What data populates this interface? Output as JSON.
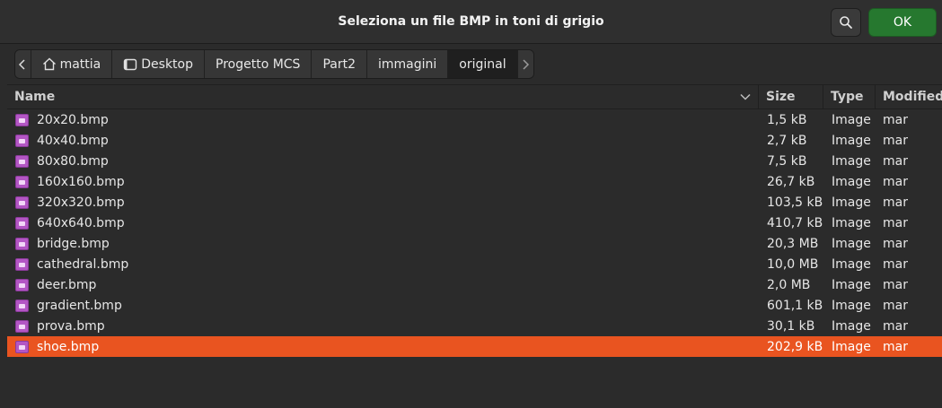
{
  "dialog": {
    "title": "Seleziona un file BMP in toni di grigio",
    "ok_label": "OK"
  },
  "pathbar": {
    "crumbs": [
      "mattia",
      "Desktop",
      "Progetto MCS",
      "Part2",
      "immagini",
      "original"
    ]
  },
  "list": {
    "columns": {
      "name": "Name",
      "size": "Size",
      "type": "Type",
      "modified": "Modified"
    },
    "files": [
      {
        "name": "20x20.bmp",
        "size": "1,5 kB",
        "type": "Image",
        "modified": "mar"
      },
      {
        "name": "40x40.bmp",
        "size": "2,7 kB",
        "type": "Image",
        "modified": "mar"
      },
      {
        "name": "80x80.bmp",
        "size": "7,5 kB",
        "type": "Image",
        "modified": "mar"
      },
      {
        "name": "160x160.bmp",
        "size": "26,7 kB",
        "type": "Image",
        "modified": "mar"
      },
      {
        "name": "320x320.bmp",
        "size": "103,5 kB",
        "type": "Image",
        "modified": "mar"
      },
      {
        "name": "640x640.bmp",
        "size": "410,7 kB",
        "type": "Image",
        "modified": "mar"
      },
      {
        "name": "bridge.bmp",
        "size": "20,3 MB",
        "type": "Image",
        "modified": "mar"
      },
      {
        "name": "cathedral.bmp",
        "size": "10,0 MB",
        "type": "Image",
        "modified": "mar"
      },
      {
        "name": "deer.bmp",
        "size": "2,0 MB",
        "type": "Image",
        "modified": "mar"
      },
      {
        "name": "gradient.bmp",
        "size": "601,1 kB",
        "type": "Image",
        "modified": "mar"
      },
      {
        "name": "prova.bmp",
        "size": "30,1 kB",
        "type": "Image",
        "modified": "mar"
      },
      {
        "name": "shoe.bmp",
        "size": "202,9 kB",
        "type": "Image",
        "modified": "mar"
      }
    ],
    "selected_index": 11
  },
  "colors": {
    "selection": "#e95420",
    "ok_button": "#26782f",
    "file_icon": "#b356c4"
  }
}
